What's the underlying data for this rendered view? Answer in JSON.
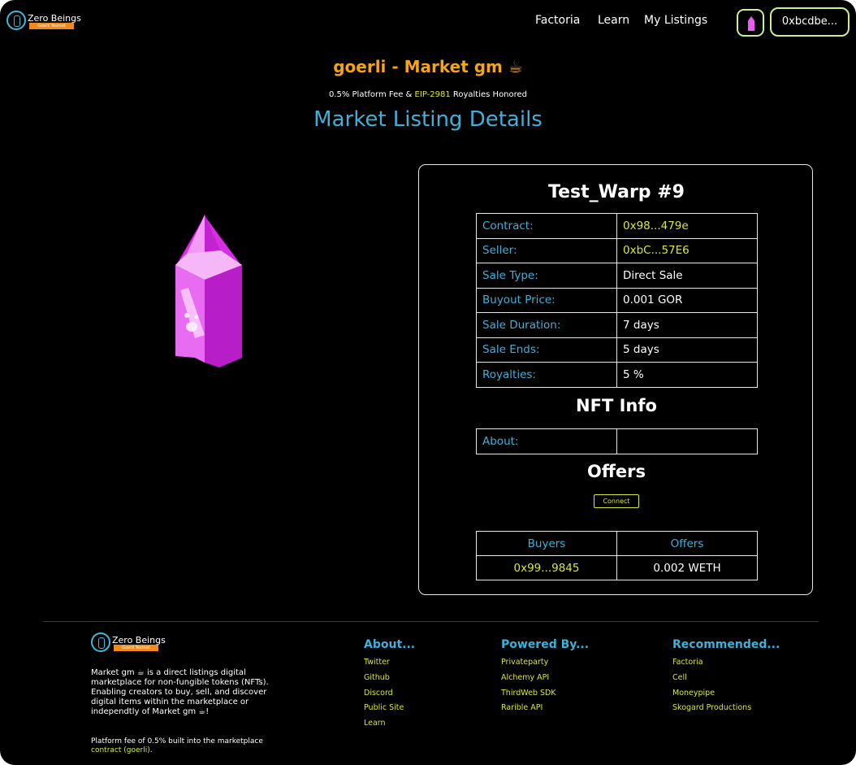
{
  "brand": {
    "name": "Zero Beings",
    "tagline": "Goerli Testnet"
  },
  "nav": {
    "factoria": "Factoria",
    "learn": "Learn",
    "my_listings": "My Listings"
  },
  "wallet": {
    "label": "0xbcdbe..."
  },
  "market": {
    "title": "goerli - Market gm ☕",
    "fee_prefix": "0.5% Platform Fee & ",
    "fee_link": "EIP-2981",
    "fee_suffix": " Royalties Honored",
    "page_title": "Market Listing Details"
  },
  "listing": {
    "name": "Test_Warp #9",
    "details": [
      {
        "label": "Contract:",
        "value": "0x98...479e",
        "is_address": true
      },
      {
        "label": "Seller:",
        "value": "0xbC...57E6",
        "is_address": true
      },
      {
        "label": "Sale Type:",
        "value": "Direct Sale",
        "is_address": false
      },
      {
        "label": "Buyout Price:",
        "value": "0.001 GOR",
        "is_address": false
      },
      {
        "label": "Sale Duration:",
        "value": "7 days",
        "is_address": false
      },
      {
        "label": "Sale Ends:",
        "value": "5 days",
        "is_address": false
      },
      {
        "label": "Royalties:",
        "value": "5 %",
        "is_address": false
      }
    ],
    "nft_info_title": "NFT Info",
    "about_label": "About:",
    "about_value": "",
    "offers_title": "Offers",
    "connect_label": "Connect",
    "offers_table": {
      "headers": [
        "Buyers",
        "Offers"
      ],
      "rows": [
        {
          "buyer": "0x99...9845",
          "offer": "0.002 WETH"
        }
      ]
    }
  },
  "footer": {
    "about_text": "Market gm ☕ is a direct listings digital marketplace for non-fungible tokens (NFTs). Enabling creators to buy, sell, and discover digital items within the marketplace or independtly of Market gm ☕!",
    "fee_text_prefix": "Platform fee of 0.5% built into the marketplace ",
    "fee_text_link": "contract (goerli)",
    "fee_text_suffix": ".",
    "columns": [
      {
        "title": "About...",
        "links": [
          "Twitter",
          "Github",
          "Discord",
          "Public Site",
          "Learn"
        ]
      },
      {
        "title": "Powered By...",
        "links": [
          "Privateparty",
          "Alchemy API",
          "ThirdWeb SDK",
          "Rarible API"
        ]
      },
      {
        "title": "Recommended...",
        "links": [
          "Factoria",
          "Cell",
          "Moneypipe",
          "Skogard Productions"
        ]
      }
    ]
  },
  "colors": {
    "accent_blue": "#3fb0d9",
    "accent_yellow": "#d9e832",
    "accent_orange": "#f2a51a",
    "wallet_border": "#c9f08e",
    "crystal": "#e55df1"
  }
}
